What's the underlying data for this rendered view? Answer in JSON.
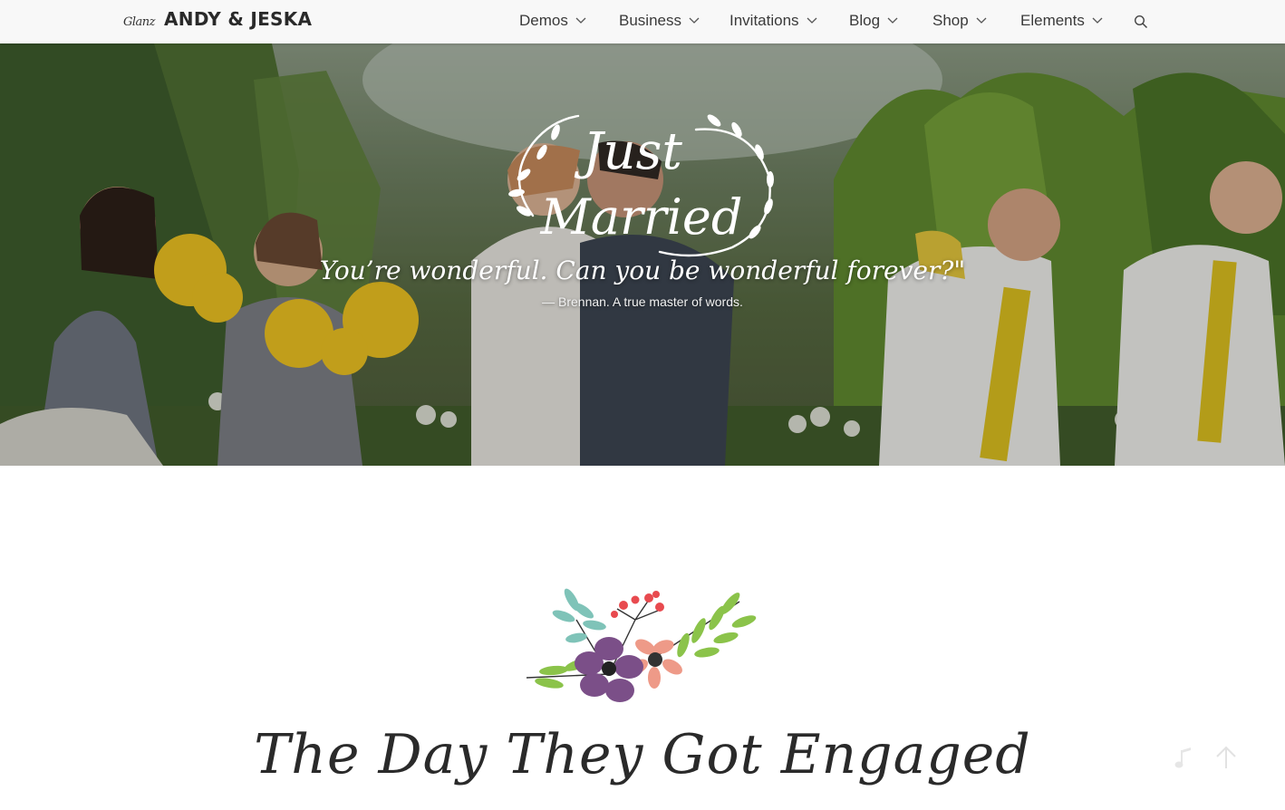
{
  "header": {
    "logo_script": "Glanz",
    "logo_name": "ANDY & JESKA",
    "nav": [
      {
        "label": "Demos"
      },
      {
        "label": "Business"
      },
      {
        "label": "Invitations"
      },
      {
        "label": "Blog"
      },
      {
        "label": "Shop"
      },
      {
        "label": "Elements"
      }
    ],
    "search_icon": "search-icon"
  },
  "hero": {
    "badge_text_line1": "Just",
    "badge_text_line2": "Married",
    "quote": "You’re wonderful. Can you be wonderful forever?\"",
    "attribution": "— Brennan. A true master of words."
  },
  "section": {
    "title": "The Day They Got Engaged",
    "ornament_icon": "floral-ornament-icon"
  },
  "floating": {
    "music_icon": "music-note-icon",
    "top_icon": "arrow-up-icon"
  },
  "colors": {
    "header_bg": "#f8f8f8",
    "text_dark": "#2a2a2a",
    "flower_purple": "#7b4f88",
    "flower_pink": "#ee9a88",
    "leaf_green": "#8bc34a",
    "leaf_teal": "#7fc3b8",
    "berry_red": "#e84a4f"
  }
}
